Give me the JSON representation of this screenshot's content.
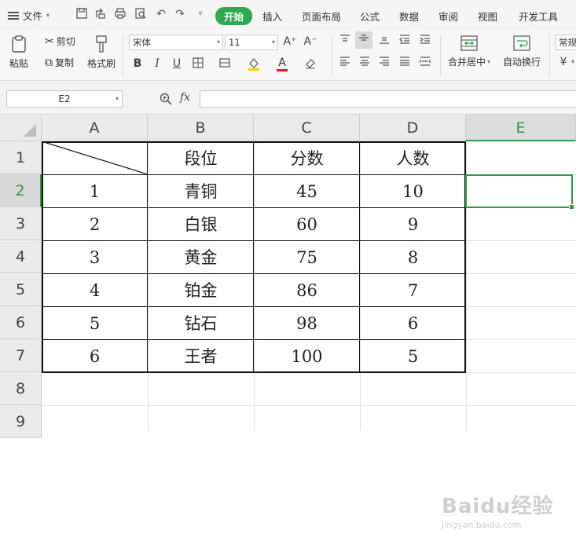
{
  "menubar": {
    "file_label": "文件",
    "tabs": [
      "开始",
      "插入",
      "页面布局",
      "公式",
      "数据",
      "审阅",
      "视图",
      "开发工具"
    ],
    "active_tab": "开始"
  },
  "ribbon": {
    "paste_label": "粘贴",
    "cut_label": "剪切",
    "copy_label": "复制",
    "format_painter_label": "格式刷",
    "font_name": "宋体",
    "font_size": "11",
    "grow_font": "A⁺",
    "shrink_font": "A⁻",
    "bold": "B",
    "italic": "I",
    "underline": "U",
    "font_color_letter": "A",
    "merge_center_label": "合并居中",
    "wrap_text_label": "自动换行",
    "number_format": "常规",
    "colors": {
      "accent": "#2fa84f",
      "font_color_bar": "#e02020",
      "fill_color_bar": "#f5d000"
    }
  },
  "formula_bar": {
    "name_box": "E2",
    "fx_label": "fx",
    "formula": ""
  },
  "sheet": {
    "columns": [
      "A",
      "B",
      "C",
      "D",
      "E"
    ],
    "rows": [
      "1",
      "2",
      "3",
      "4",
      "5",
      "6",
      "7",
      "8",
      "9"
    ],
    "selected_cell": "E2",
    "header_row": [
      "",
      "段位",
      "分数",
      "人数"
    ],
    "data": [
      [
        "1",
        "青铜",
        "45",
        "10"
      ],
      [
        "2",
        "白银",
        "60",
        "9"
      ],
      [
        "3",
        "黄金",
        "75",
        "8"
      ],
      [
        "4",
        "铂金",
        "86",
        "7"
      ],
      [
        "5",
        "钻石",
        "98",
        "6"
      ],
      [
        "6",
        "王者",
        "100",
        "5"
      ]
    ]
  },
  "watermark": {
    "brand": "Baidu经验",
    "url": "jingyan.baidu.com"
  }
}
